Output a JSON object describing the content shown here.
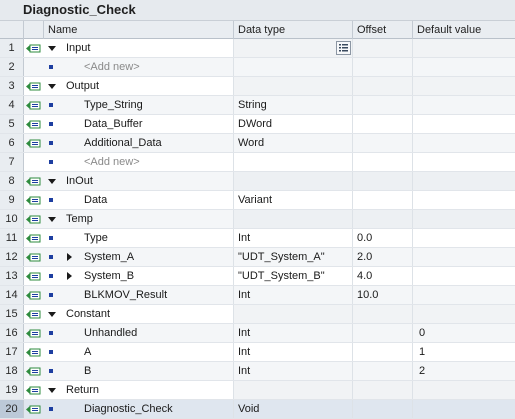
{
  "title": "Diagnostic_Check",
  "columns": {
    "name": "Name",
    "data_type": "Data type",
    "offset": "Offset",
    "default_value": "Default value"
  },
  "rows": [
    {
      "num": "1",
      "kind": "section",
      "name": "Input",
      "type": "",
      "offset": "",
      "default": ""
    },
    {
      "num": "2",
      "kind": "addnew",
      "name": "<Add new>",
      "type": "",
      "offset": "",
      "default": ""
    },
    {
      "num": "3",
      "kind": "section",
      "name": "Output",
      "type": "",
      "offset": "",
      "default": ""
    },
    {
      "num": "4",
      "kind": "var",
      "name": "Type_String",
      "type": "String",
      "offset": "",
      "default": ""
    },
    {
      "num": "5",
      "kind": "var",
      "name": "Data_Buffer",
      "type": "DWord",
      "offset": "",
      "default": ""
    },
    {
      "num": "6",
      "kind": "var",
      "name": "Additional_Data",
      "type": "Word",
      "offset": "",
      "default": ""
    },
    {
      "num": "7",
      "kind": "addnew",
      "name": "<Add new>",
      "type": "",
      "offset": "",
      "default": ""
    },
    {
      "num": "8",
      "kind": "section",
      "name": "InOut",
      "type": "",
      "offset": "",
      "default": ""
    },
    {
      "num": "9",
      "kind": "var",
      "name": "Data",
      "type": "Variant",
      "offset": "",
      "default": ""
    },
    {
      "num": "10",
      "kind": "section",
      "name": "Temp",
      "type": "",
      "offset": "",
      "default": ""
    },
    {
      "num": "11",
      "kind": "var",
      "name": "Type",
      "type": "Int",
      "offset": "0.0",
      "default": ""
    },
    {
      "num": "12",
      "kind": "struct",
      "name": "System_A",
      "type": "\"UDT_System_A\"",
      "offset": "2.0",
      "default": ""
    },
    {
      "num": "13",
      "kind": "struct",
      "name": "System_B",
      "type": "\"UDT_System_B\"",
      "offset": "4.0",
      "default": ""
    },
    {
      "num": "14",
      "kind": "var",
      "name": "BLKMOV_Result",
      "type": "Int",
      "offset": "10.0",
      "default": ""
    },
    {
      "num": "15",
      "kind": "section",
      "name": "Constant",
      "type": "",
      "offset": "",
      "default": ""
    },
    {
      "num": "16",
      "kind": "var",
      "name": "Unhandled",
      "type": "Int",
      "offset": "",
      "default": "0"
    },
    {
      "num": "17",
      "kind": "var",
      "name": "A",
      "type": "Int",
      "offset": "",
      "default": "1"
    },
    {
      "num": "18",
      "kind": "var",
      "name": "B",
      "type": "Int",
      "offset": "",
      "default": "2"
    },
    {
      "num": "19",
      "kind": "section",
      "name": "Return",
      "type": "",
      "offset": "",
      "default": ""
    },
    {
      "num": "20",
      "kind": "var",
      "name": "Diagnostic_Check",
      "type": "Void",
      "offset": "",
      "default": ""
    }
  ],
  "colors": {
    "section_shade": "#edf0f3",
    "icon_green": "#2e8b3e",
    "icon_blue": "#1d3ea0",
    "selected_row": "#dfe6ef"
  },
  "icons": {
    "interface": "interface-port-icon",
    "expand": "expand-caret-icon",
    "collapsed": "collapsed-caret-icon",
    "bullet": "variable-bullet-icon",
    "cell_button": "edit-list-icon"
  }
}
